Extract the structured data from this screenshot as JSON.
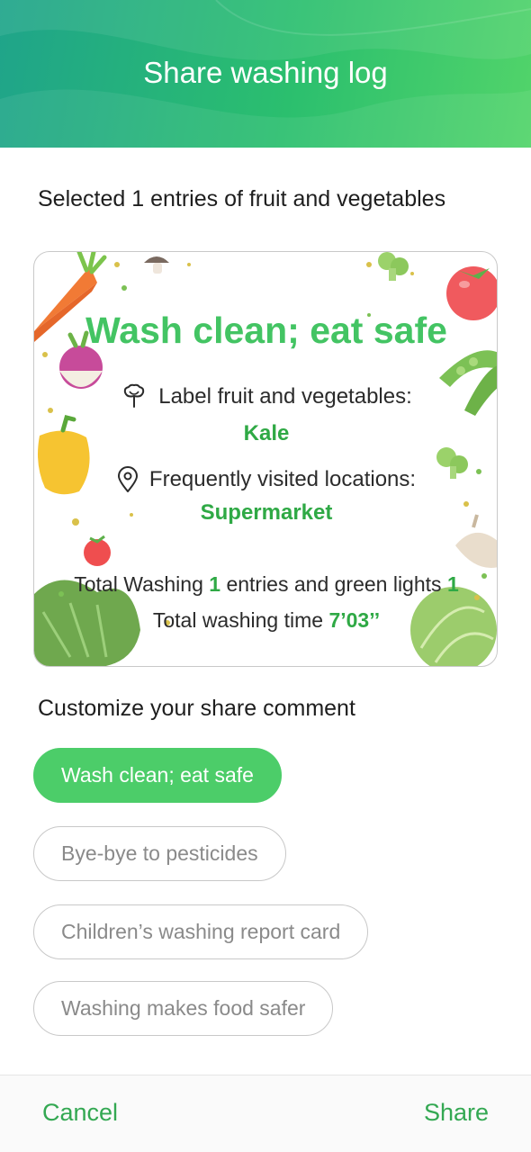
{
  "header": {
    "title": "Share washing log"
  },
  "selection": {
    "text": "Selected 1 entries of fruit and vegetables"
  },
  "card": {
    "title": "Wash clean; eat safe",
    "label_caption": "Label fruit and vegetables:",
    "label_value": "Kale",
    "location_caption": "Frequently visited locations:",
    "location_value": "Supermarket",
    "total_prefix": "Total Washing",
    "total_entries": "1",
    "total_middle": "entries and green lights",
    "green_lights": "1",
    "time_prefix": "Total washing time",
    "time_value": "7’03’’"
  },
  "customize": {
    "label": "Customize your share comment",
    "options": [
      {
        "label": "Wash clean; eat safe",
        "selected": true
      },
      {
        "label": "Bye-bye to pesticides",
        "selected": false
      },
      {
        "label": "Children’s washing report card",
        "selected": false
      },
      {
        "label": "Washing makes food safer",
        "selected": false
      }
    ]
  },
  "footer": {
    "cancel_label": "Cancel",
    "share_label": "Share"
  },
  "colors": {
    "accent": "#4ccd69",
    "accent_text": "#2fa945",
    "header_start": "#1fa48a",
    "header_end": "#52d46a"
  },
  "icons": {
    "label_icon": "vegetable-icon",
    "location_icon": "location-pin-icon"
  }
}
